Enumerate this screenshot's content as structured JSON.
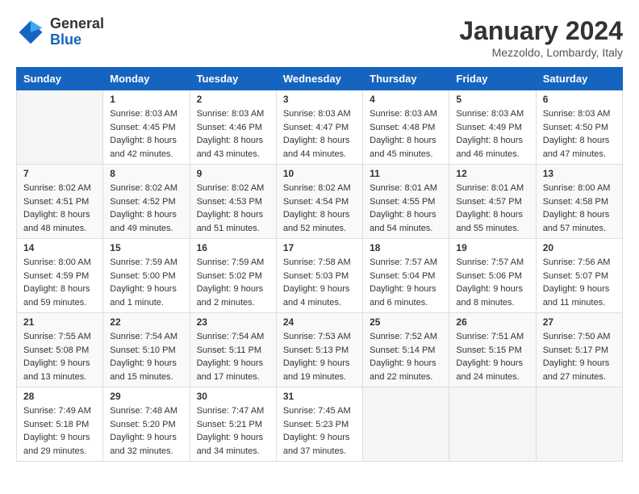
{
  "logo": {
    "name_line1": "General",
    "name_line2": "Blue"
  },
  "title": "January 2024",
  "subtitle": "Mezzoldo, Lombardy, Italy",
  "headers": [
    "Sunday",
    "Monday",
    "Tuesday",
    "Wednesday",
    "Thursday",
    "Friday",
    "Saturday"
  ],
  "weeks": [
    [
      {
        "day": "",
        "sunrise": "",
        "sunset": "",
        "daylight": ""
      },
      {
        "day": "1",
        "sunrise": "8:03 AM",
        "sunset": "4:45 PM",
        "daylight": "8 hours and 42 minutes."
      },
      {
        "day": "2",
        "sunrise": "8:03 AM",
        "sunset": "4:46 PM",
        "daylight": "8 hours and 43 minutes."
      },
      {
        "day": "3",
        "sunrise": "8:03 AM",
        "sunset": "4:47 PM",
        "daylight": "8 hours and 44 minutes."
      },
      {
        "day": "4",
        "sunrise": "8:03 AM",
        "sunset": "4:48 PM",
        "daylight": "8 hours and 45 minutes."
      },
      {
        "day": "5",
        "sunrise": "8:03 AM",
        "sunset": "4:49 PM",
        "daylight": "8 hours and 46 minutes."
      },
      {
        "day": "6",
        "sunrise": "8:03 AM",
        "sunset": "4:50 PM",
        "daylight": "8 hours and 47 minutes."
      }
    ],
    [
      {
        "day": "7",
        "sunrise": "8:02 AM",
        "sunset": "4:51 PM",
        "daylight": "8 hours and 48 minutes."
      },
      {
        "day": "8",
        "sunrise": "8:02 AM",
        "sunset": "4:52 PM",
        "daylight": "8 hours and 49 minutes."
      },
      {
        "day": "9",
        "sunrise": "8:02 AM",
        "sunset": "4:53 PM",
        "daylight": "8 hours and 51 minutes."
      },
      {
        "day": "10",
        "sunrise": "8:02 AM",
        "sunset": "4:54 PM",
        "daylight": "8 hours and 52 minutes."
      },
      {
        "day": "11",
        "sunrise": "8:01 AM",
        "sunset": "4:55 PM",
        "daylight": "8 hours and 54 minutes."
      },
      {
        "day": "12",
        "sunrise": "8:01 AM",
        "sunset": "4:57 PM",
        "daylight": "8 hours and 55 minutes."
      },
      {
        "day": "13",
        "sunrise": "8:00 AM",
        "sunset": "4:58 PM",
        "daylight": "8 hours and 57 minutes."
      }
    ],
    [
      {
        "day": "14",
        "sunrise": "8:00 AM",
        "sunset": "4:59 PM",
        "daylight": "8 hours and 59 minutes."
      },
      {
        "day": "15",
        "sunrise": "7:59 AM",
        "sunset": "5:00 PM",
        "daylight": "9 hours and 1 minute."
      },
      {
        "day": "16",
        "sunrise": "7:59 AM",
        "sunset": "5:02 PM",
        "daylight": "9 hours and 2 minutes."
      },
      {
        "day": "17",
        "sunrise": "7:58 AM",
        "sunset": "5:03 PM",
        "daylight": "9 hours and 4 minutes."
      },
      {
        "day": "18",
        "sunrise": "7:57 AM",
        "sunset": "5:04 PM",
        "daylight": "9 hours and 6 minutes."
      },
      {
        "day": "19",
        "sunrise": "7:57 AM",
        "sunset": "5:06 PM",
        "daylight": "9 hours and 8 minutes."
      },
      {
        "day": "20",
        "sunrise": "7:56 AM",
        "sunset": "5:07 PM",
        "daylight": "9 hours and 11 minutes."
      }
    ],
    [
      {
        "day": "21",
        "sunrise": "7:55 AM",
        "sunset": "5:08 PM",
        "daylight": "9 hours and 13 minutes."
      },
      {
        "day": "22",
        "sunrise": "7:54 AM",
        "sunset": "5:10 PM",
        "daylight": "9 hours and 15 minutes."
      },
      {
        "day": "23",
        "sunrise": "7:54 AM",
        "sunset": "5:11 PM",
        "daylight": "9 hours and 17 minutes."
      },
      {
        "day": "24",
        "sunrise": "7:53 AM",
        "sunset": "5:13 PM",
        "daylight": "9 hours and 19 minutes."
      },
      {
        "day": "25",
        "sunrise": "7:52 AM",
        "sunset": "5:14 PM",
        "daylight": "9 hours and 22 minutes."
      },
      {
        "day": "26",
        "sunrise": "7:51 AM",
        "sunset": "5:15 PM",
        "daylight": "9 hours and 24 minutes."
      },
      {
        "day": "27",
        "sunrise": "7:50 AM",
        "sunset": "5:17 PM",
        "daylight": "9 hours and 27 minutes."
      }
    ],
    [
      {
        "day": "28",
        "sunrise": "7:49 AM",
        "sunset": "5:18 PM",
        "daylight": "9 hours and 29 minutes."
      },
      {
        "day": "29",
        "sunrise": "7:48 AM",
        "sunset": "5:20 PM",
        "daylight": "9 hours and 32 minutes."
      },
      {
        "day": "30",
        "sunrise": "7:47 AM",
        "sunset": "5:21 PM",
        "daylight": "9 hours and 34 minutes."
      },
      {
        "day": "31",
        "sunrise": "7:45 AM",
        "sunset": "5:23 PM",
        "daylight": "9 hours and 37 minutes."
      },
      {
        "day": "",
        "sunrise": "",
        "sunset": "",
        "daylight": ""
      },
      {
        "day": "",
        "sunrise": "",
        "sunset": "",
        "daylight": ""
      },
      {
        "day": "",
        "sunrise": "",
        "sunset": "",
        "daylight": ""
      }
    ]
  ],
  "labels": {
    "sunrise_prefix": "Sunrise: ",
    "sunset_prefix": "Sunset: ",
    "daylight_prefix": "Daylight: "
  }
}
